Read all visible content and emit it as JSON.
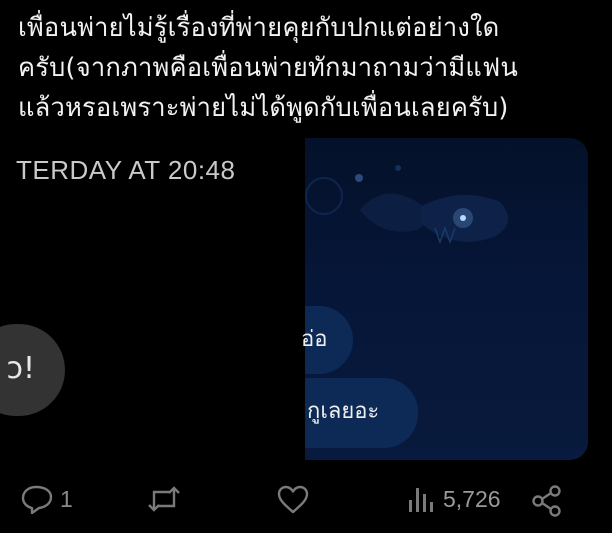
{
  "post": {
    "lines": [
      "เพื่อนพ่ายไม่รู้เรื่องที่พ่ายคุยกับปกแต่อย่างใด",
      "ครับ(จากภาพคือเพื่อนพ่ายทักมาถามว่ามีแฟน",
      "แล้วหรอเพราะพ่ายไม่ได้พูดกับเพื่อนเลยครับ)"
    ]
  },
  "chat": {
    "timestamp": "TERDAY AT 20:48",
    "left_bubble_text": "ɔ!",
    "right_bubble_1": "อ่อ",
    "right_bubble_2": "กูเลยอะ"
  },
  "actions": {
    "reply_count": "1",
    "view_count": "5,726"
  },
  "colors": {
    "background": "#000000",
    "bubble_blue": "#0d2a57",
    "bubble_gray": "#333333",
    "icon_gray": "#7a7a7a"
  }
}
